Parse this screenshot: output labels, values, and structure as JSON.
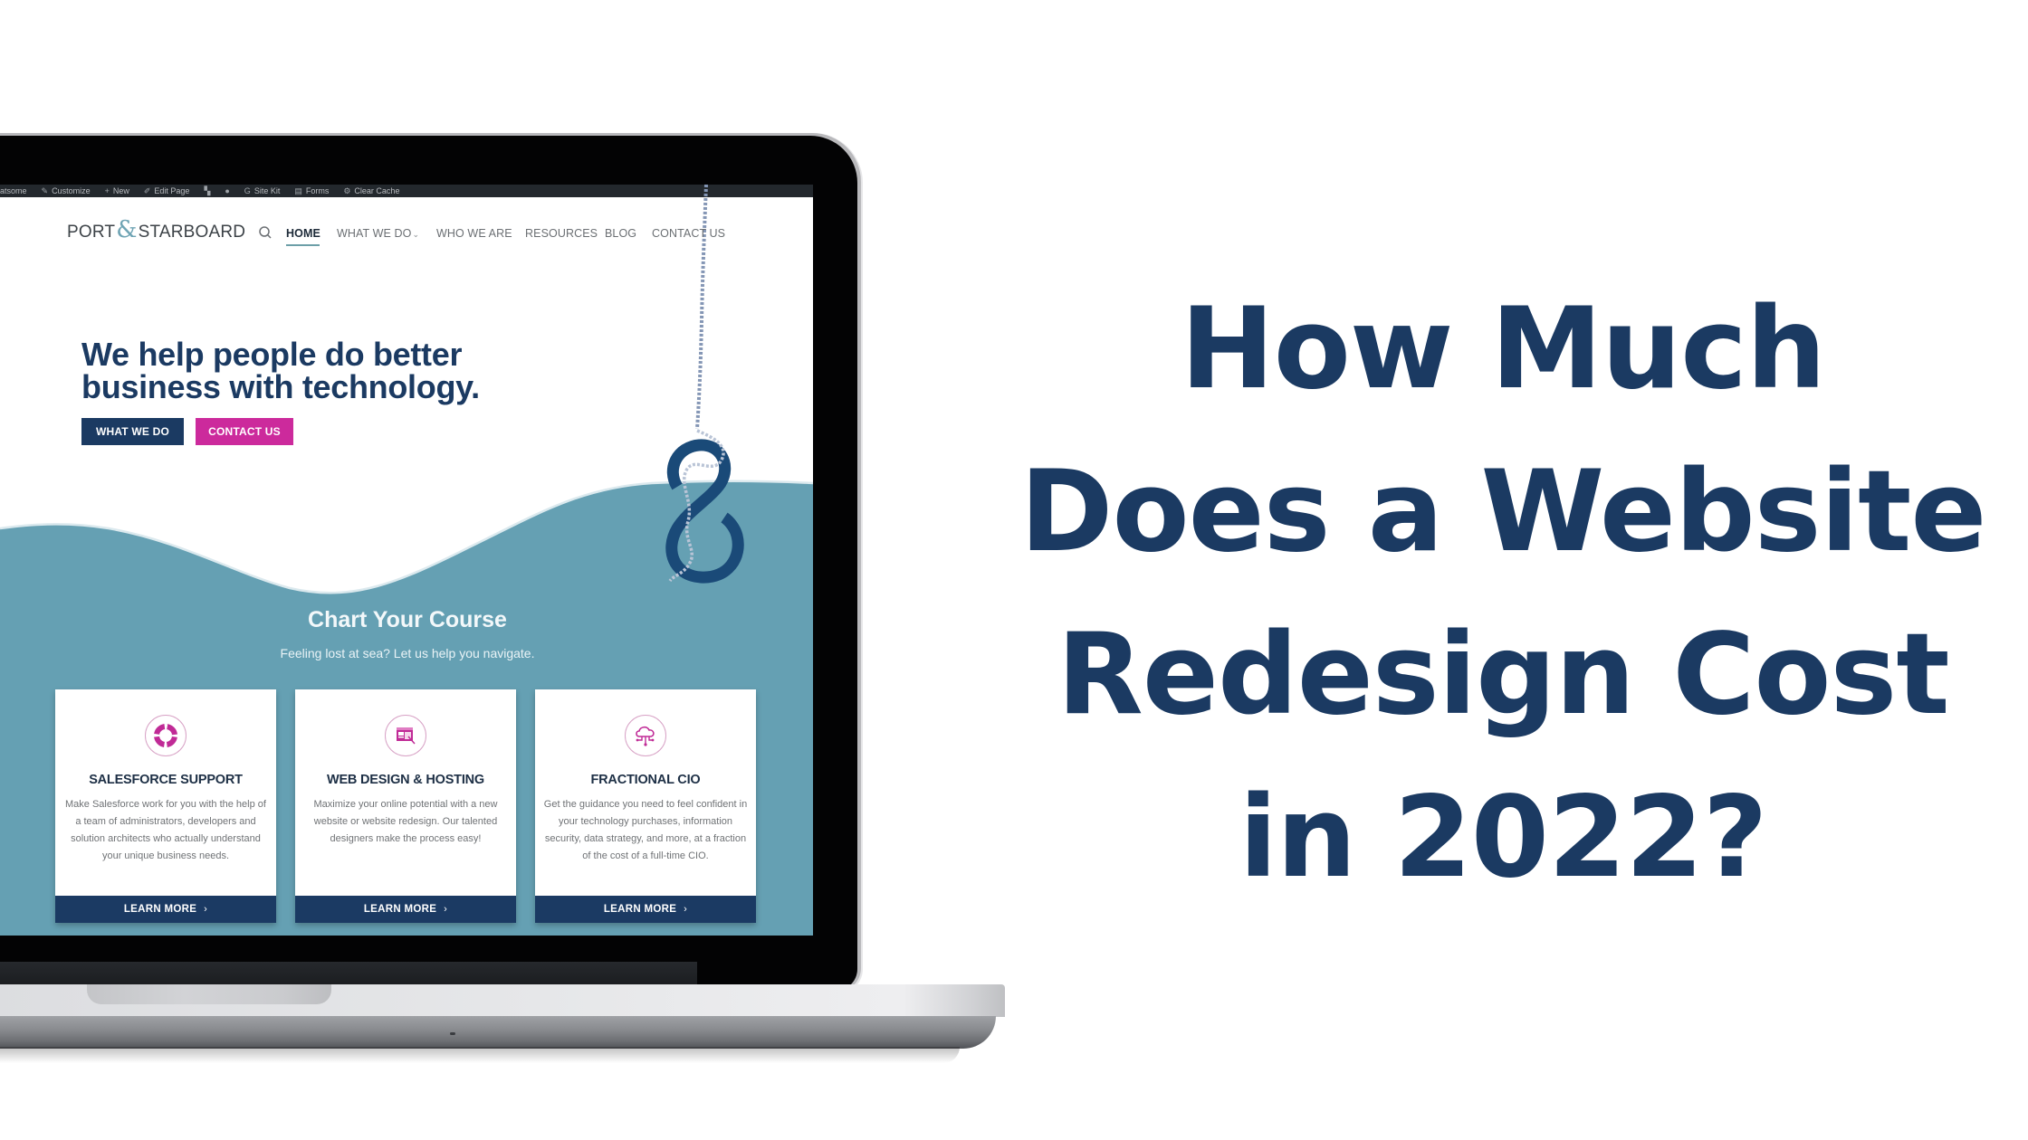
{
  "headline": {
    "lines": [
      "How Much",
      "Does a Website",
      "Redesign Cost",
      "in 2022?"
    ],
    "color": "#1b3a62"
  },
  "admin_bar": {
    "items": [
      {
        "icon": "wordpress-icon",
        "label": "atsome"
      },
      {
        "icon": "brush-icon",
        "label": "Customize"
      },
      {
        "icon": "plus-icon",
        "label": "New"
      },
      {
        "icon": "pencil-icon",
        "label": "Edit Page"
      },
      {
        "icon": "plugin-icon",
        "label": ""
      },
      {
        "icon": "dot-icon",
        "label": ""
      },
      {
        "icon": "google-icon",
        "label": "Site Kit"
      },
      {
        "icon": "forms-icon",
        "label": "Forms"
      },
      {
        "icon": "cache-icon",
        "label": "Clear Cache"
      }
    ]
  },
  "site": {
    "logo": {
      "left": "PORT",
      "amp": "&",
      "right": "STARBOARD"
    },
    "nav": [
      {
        "label": "HOME",
        "active": true
      },
      {
        "label": "WHAT WE DO",
        "dropdown": true
      },
      {
        "label": "WHO WE ARE"
      },
      {
        "label": "RESOURCES"
      },
      {
        "label": "BLOG"
      },
      {
        "label": "CONTACT US"
      }
    ],
    "hero": {
      "heading_line1": "We help people do better",
      "heading_line2": "business with technology.",
      "primary_button": "WHAT WE DO",
      "secondary_button": "CONTACT US"
    },
    "section": {
      "title": "Chart Your Course",
      "subtitle": "Feeling lost at sea?  Let us help you navigate."
    },
    "cards": [
      {
        "icon": "lifebuoy-icon",
        "title": "SALESFORCE SUPPORT",
        "body": "Make Salesforce work for you with the help of a team of administrators, developers and solution architects who actually understand your unique business needs.",
        "cta": "LEARN MORE",
        "cta_icon": "›"
      },
      {
        "icon": "web-design-icon",
        "title": "WEB DESIGN & HOSTING",
        "body": "Maximize your online potential with a new website or website redesign. Our talented designers make the process easy!",
        "cta": "LEARN MORE",
        "cta_icon": "›"
      },
      {
        "icon": "cloud-network-icon",
        "title": "FRACTIONAL CIO",
        "body": "Get the guidance you need to feel confident in your technology purchases, information security, data strategy, and more, at a fraction of the cost of a full-time CIO.",
        "cta": "LEARN MORE",
        "cta_icon": "›"
      }
    ],
    "colors": {
      "navy": "#1b3a62",
      "magenta": "#cc2a9c",
      "teal": "#65a0b3",
      "admin_bar": "#23282d"
    }
  }
}
